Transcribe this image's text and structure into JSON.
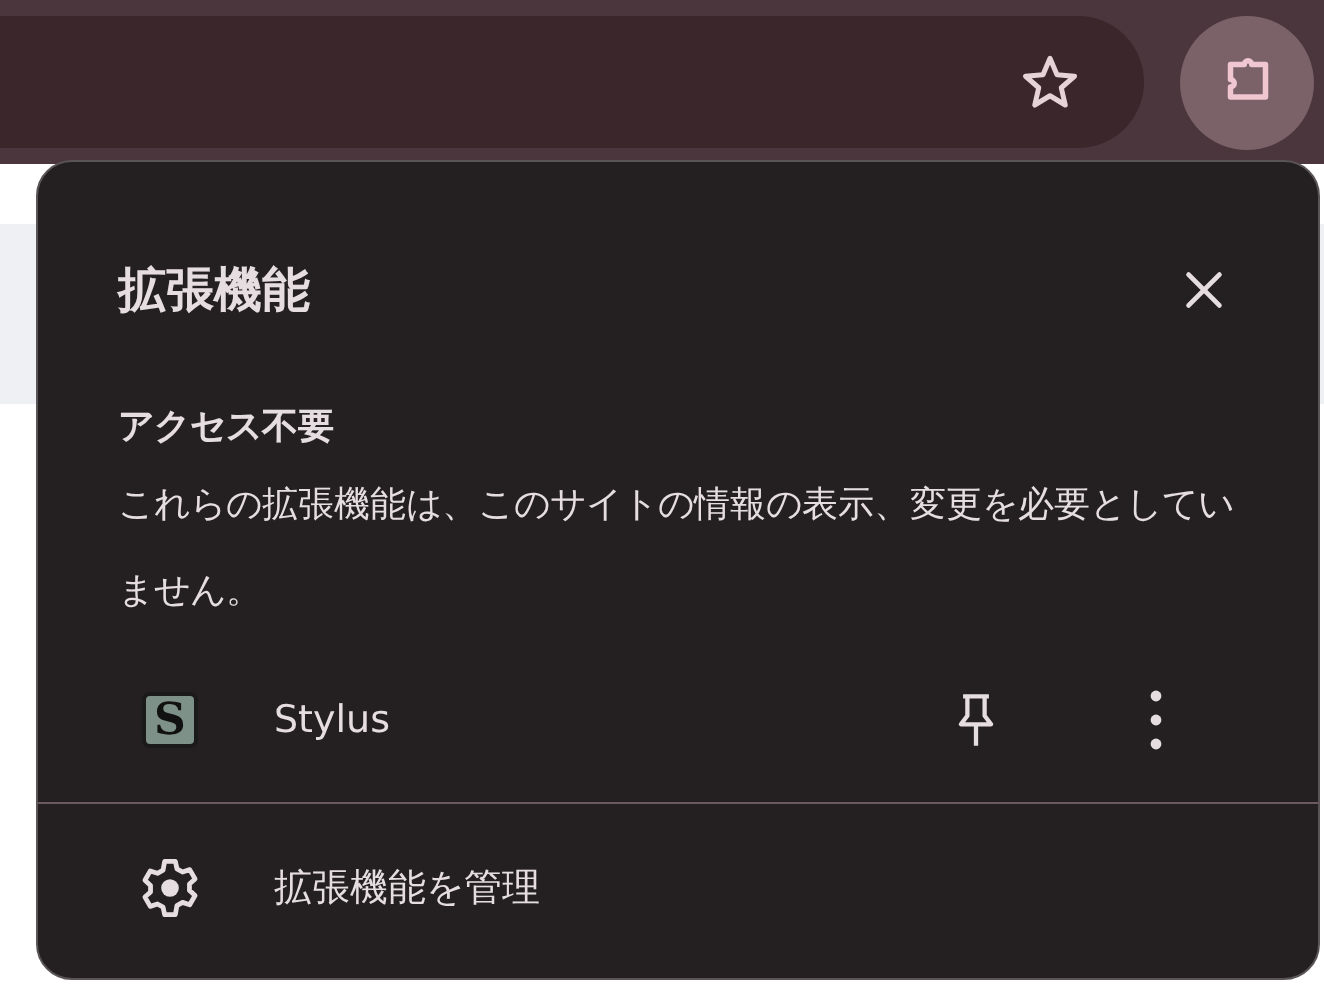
{
  "popup": {
    "title": "拡張機能",
    "section_heading": "アクセス不要",
    "description": "これらの拡張機能は、このサイトの情報の表示、変更を必要としていません。",
    "extensions": [
      {
        "icon_letter": "S",
        "name": "Stylus",
        "pinned": false
      }
    ],
    "manage_label": "拡張機能を管理"
  }
}
